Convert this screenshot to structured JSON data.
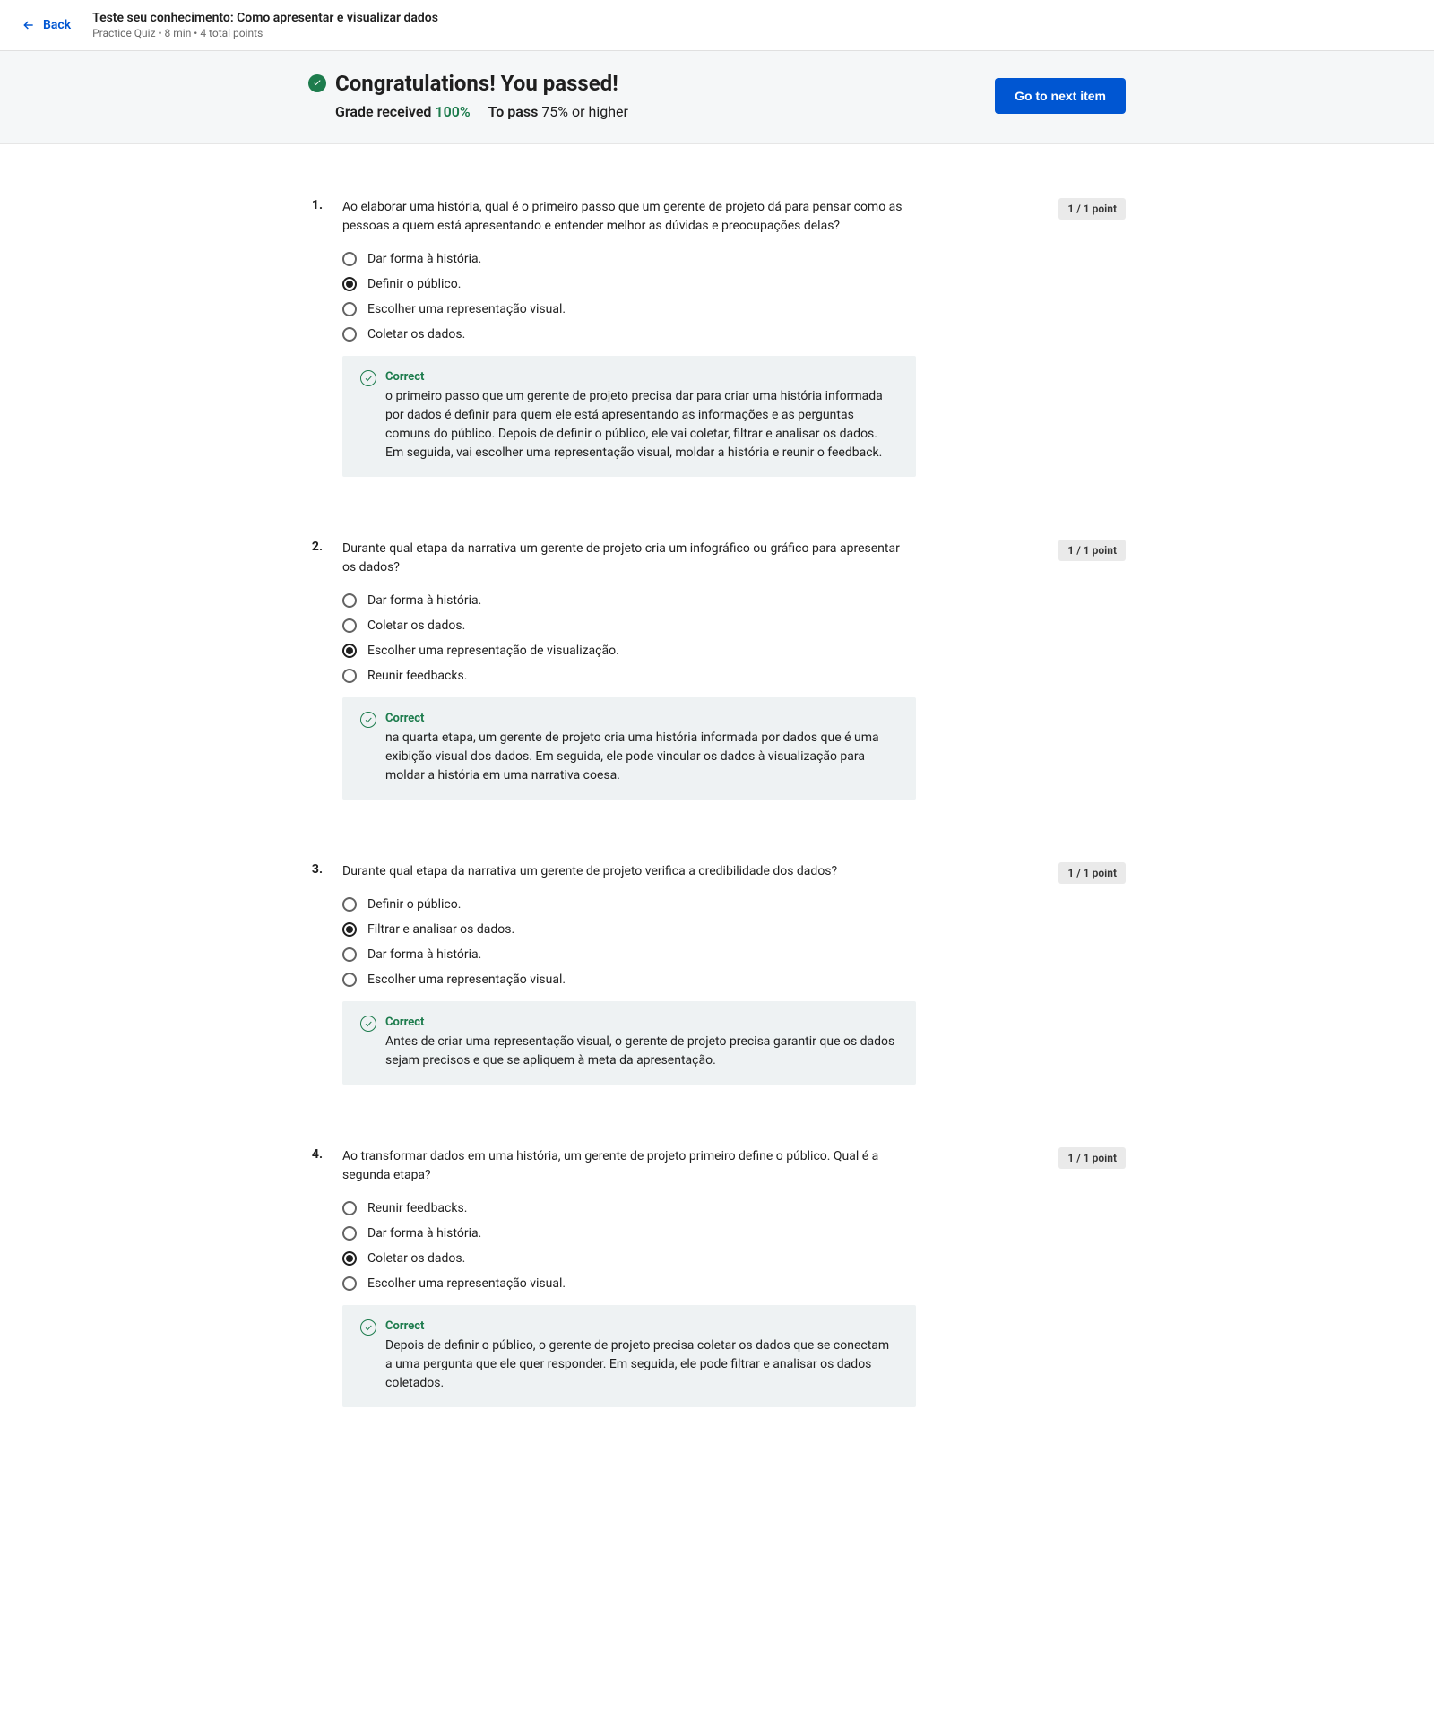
{
  "header": {
    "back_label": "Back",
    "title": "Teste seu conhecimento: Como apresentar e visualizar dados",
    "meta": "Practice Quiz • 8 min • 4 total points"
  },
  "result": {
    "congrats": "Congratulations! You passed!",
    "grade_label": "Grade received ",
    "grade_value": "100%",
    "pass_label": "To pass ",
    "pass_value": "75% or higher",
    "next_button": "Go to next item"
  },
  "questions": [
    {
      "number": "1.",
      "text": "Ao elaborar uma história, qual é o primeiro passo que um gerente de projeto dá para pensar como as pessoas a quem está apresentando e entender melhor as dúvidas e preocupações delas?",
      "points": "1 / 1 point",
      "options": [
        {
          "label": "Dar forma à história.",
          "selected": false
        },
        {
          "label": "Definir o público.",
          "selected": true
        },
        {
          "label": "Escolher uma representação visual.",
          "selected": false
        },
        {
          "label": "Coletar os dados.",
          "selected": false
        }
      ],
      "feedback": {
        "title": "Correct",
        "text": "o primeiro passo que um gerente de projeto precisa dar para criar uma história informada por dados é definir para quem ele está apresentando as informações e as perguntas comuns do público. Depois de definir o público, ele vai coletar, filtrar e analisar os dados. Em seguida, vai escolher uma representação visual, moldar a história e reunir o feedback."
      }
    },
    {
      "number": "2.",
      "text": "Durante qual etapa da narrativa um gerente de projeto cria um infográfico ou gráfico para apresentar os dados?",
      "points": "1 / 1 point",
      "options": [
        {
          "label": "Dar forma à história.",
          "selected": false
        },
        {
          "label": "Coletar os dados.",
          "selected": false
        },
        {
          "label": "Escolher uma representação de visualização.",
          "selected": true
        },
        {
          "label": "Reunir feedbacks.",
          "selected": false
        }
      ],
      "feedback": {
        "title": "Correct",
        "text": "na quarta etapa, um gerente de projeto cria uma história informada por dados que é uma exibição visual dos dados. Em seguida, ele pode vincular os dados à visualização para moldar a história em uma narrativa coesa."
      }
    },
    {
      "number": "3.",
      "text": "Durante qual etapa da narrativa um gerente de projeto verifica a credibilidade dos dados?",
      "points": "1 / 1 point",
      "options": [
        {
          "label": "Definir o público.",
          "selected": false
        },
        {
          "label": "Filtrar e analisar os dados.",
          "selected": true
        },
        {
          "label": "Dar forma à história.",
          "selected": false
        },
        {
          "label": "Escolher uma representação visual.",
          "selected": false
        }
      ],
      "feedback": {
        "title": "Correct",
        "text": "Antes de criar uma representação visual, o gerente de projeto precisa garantir que os dados sejam precisos e que se apliquem à meta da apresentação."
      }
    },
    {
      "number": "4.",
      "text": "Ao transformar dados em uma história, um gerente de projeto primeiro define o público. Qual é a segunda etapa?",
      "points": "1 / 1 point",
      "options": [
        {
          "label": "Reunir feedbacks.",
          "selected": false
        },
        {
          "label": "Dar forma à história.",
          "selected": false
        },
        {
          "label": "Coletar os dados.",
          "selected": true
        },
        {
          "label": "Escolher uma representação visual.",
          "selected": false
        }
      ],
      "feedback": {
        "title": "Correct",
        "text": "Depois de definir o público, o gerente de projeto precisa coletar os dados que se conectam a uma pergunta que ele quer responder. Em seguida, ele pode filtrar e analisar os dados coletados."
      }
    }
  ]
}
